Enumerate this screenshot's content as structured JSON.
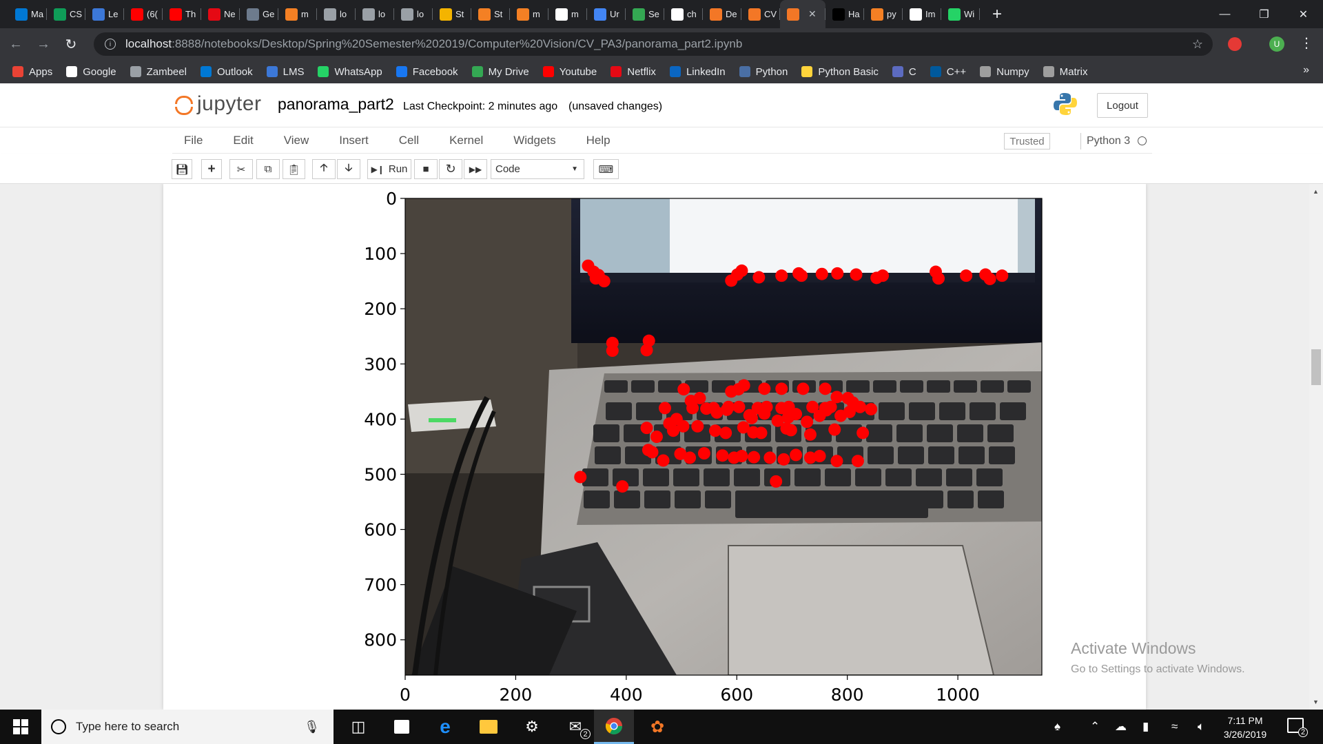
{
  "browser": {
    "tabs": [
      {
        "label": "Ma",
        "icon": "outlook-icon",
        "color": "#0078d4"
      },
      {
        "label": "CS",
        "icon": "plus-sheet-icon",
        "color": "#0f9d58"
      },
      {
        "label": "Le",
        "icon": "lms-icon",
        "color": "#3c78d8"
      },
      {
        "label": "(6(",
        "icon": "youtube-icon",
        "color": "#ff0000"
      },
      {
        "label": "Th",
        "icon": "youtube-icon",
        "color": "#ff0000"
      },
      {
        "label": "Ne",
        "icon": "netflix-icon",
        "color": "#e50914"
      },
      {
        "label": "Ge",
        "icon": "page-icon",
        "color": "#6d7b8d"
      },
      {
        "label": "m",
        "icon": "stack-icon",
        "color": "#f48024"
      },
      {
        "label": "lo",
        "icon": "file-icon",
        "color": "#9aa0a6"
      },
      {
        "label": "lo",
        "icon": "file-icon",
        "color": "#9aa0a6"
      },
      {
        "label": "lo",
        "icon": "file-icon",
        "color": "#9aa0a6"
      },
      {
        "label": "St",
        "icon": "star-icon",
        "color": "#f4b400"
      },
      {
        "label": "St",
        "icon": "diamond-icon",
        "color": "#f48024"
      },
      {
        "label": "m",
        "icon": "stack-icon",
        "color": "#f48024"
      },
      {
        "label": "m",
        "icon": "google-icon",
        "color": "#ffffff"
      },
      {
        "label": "Ur",
        "icon": "drive-icon",
        "color": "#4285f4"
      },
      {
        "label": "Se",
        "icon": "pen-icon",
        "color": "#34a853"
      },
      {
        "label": "ch",
        "icon": "google-icon",
        "color": "#ffffff"
      },
      {
        "label": "De",
        "icon": "jupyter-icon",
        "color": "#f37726"
      },
      {
        "label": "CV",
        "icon": "notebook-icon",
        "color": "#f37726"
      },
      {
        "label": "",
        "icon": "notebook-icon",
        "color": "#f37726",
        "active": true
      },
      {
        "label": "Ha",
        "icon": "github-icon",
        "color": "#000000"
      },
      {
        "label": "py",
        "icon": "stack-icon",
        "color": "#f48024"
      },
      {
        "label": "Im",
        "icon": "pinwheel-icon",
        "color": "#ffffff"
      },
      {
        "label": "Wi",
        "icon": "whatsapp-icon",
        "color": "#25d366"
      }
    ],
    "url_host": "localhost",
    "url_rest": ":8888/notebooks/Desktop/Spring%20Semester%202019/Computer%20Vision/CV_PA3/panorama_part2.ipynb",
    "profile_initial": "U",
    "bookmarks": [
      {
        "label": "Apps",
        "icon": "apps-grid-icon",
        "color": "#ea4335"
      },
      {
        "label": "Google",
        "icon": "google-icon",
        "color": "#ffffff"
      },
      {
        "label": "Zambeel",
        "icon": "page-icon",
        "color": "#9aa0a6"
      },
      {
        "label": "Outlook",
        "icon": "outlook-icon",
        "color": "#0078d4"
      },
      {
        "label": "LMS",
        "icon": "lms-icon",
        "color": "#3c78d8"
      },
      {
        "label": "WhatsApp",
        "icon": "whatsapp-icon",
        "color": "#25d366"
      },
      {
        "label": "Facebook",
        "icon": "facebook-icon",
        "color": "#1877f2"
      },
      {
        "label": "My Drive",
        "icon": "drive-icon",
        "color": "#34a853"
      },
      {
        "label": "Youtube",
        "icon": "youtube-icon",
        "color": "#ff0000"
      },
      {
        "label": "Netflix",
        "icon": "netflix-icon",
        "color": "#e50914"
      },
      {
        "label": "LinkedIn",
        "icon": "linkedin-icon",
        "color": "#0a66c2"
      },
      {
        "label": "Python",
        "icon": "globe-icon",
        "color": "#4a6fa5"
      },
      {
        "label": "Python Basic",
        "icon": "python-icon",
        "color": "#ffd43b"
      },
      {
        "label": "C",
        "icon": "c-icon",
        "color": "#5c6bc0"
      },
      {
        "label": "C++",
        "icon": "cpp-icon",
        "color": "#00599c"
      },
      {
        "label": "Numpy",
        "icon": "numpy-icon",
        "color": "#9e9e9e"
      },
      {
        "label": "Matrix",
        "icon": "r-icon",
        "color": "#9e9e9e"
      }
    ]
  },
  "jupyter": {
    "logo_text": "jupyter",
    "notebook_name": "panorama_part2",
    "checkpoint": "Last Checkpoint: 2 minutes ago",
    "status": "(unsaved changes)",
    "logout": "Logout",
    "menu": [
      "File",
      "Edit",
      "View",
      "Insert",
      "Cell",
      "Kernel",
      "Widgets",
      "Help"
    ],
    "trusted": "Trusted",
    "kernel": "Python 3",
    "run_label": "Run",
    "cell_type": "Code"
  },
  "chart_data": {
    "type": "scatter",
    "title": "",
    "xlabel": "",
    "ylabel": "",
    "xlim": [
      0,
      1152
    ],
    "ylim": [
      864,
      0
    ],
    "y_inverted": true,
    "xticks": [
      "0",
      "200",
      "400",
      "600",
      "800",
      "1000"
    ],
    "yticks": [
      "0",
      "100",
      "200",
      "300",
      "400",
      "500",
      "600",
      "700",
      "800"
    ],
    "background": "photo of laptop keyboard (imshow)",
    "marker_color": "#ff0000",
    "series": [
      {
        "points": [
          [
            331,
            122
          ],
          [
            341,
            133
          ],
          [
            345,
            145
          ],
          [
            360,
            150
          ],
          [
            350,
            139
          ],
          [
            590,
            149
          ],
          [
            601,
            138
          ],
          [
            609,
            131
          ],
          [
            640,
            143
          ],
          [
            681,
            140
          ],
          [
            712,
            136
          ],
          [
            717,
            140
          ],
          [
            754,
            137
          ],
          [
            782,
            136
          ],
          [
            816,
            138
          ],
          [
            853,
            144
          ],
          [
            864,
            140
          ],
          [
            960,
            133
          ],
          [
            965,
            145
          ],
          [
            1015,
            140
          ],
          [
            1050,
            138
          ],
          [
            1058,
            146
          ],
          [
            1080,
            140
          ],
          [
            375,
            262
          ],
          [
            375,
            276
          ],
          [
            441,
            258
          ],
          [
            437,
            275
          ],
          [
            470,
            380
          ],
          [
            478,
            408
          ],
          [
            491,
            400
          ],
          [
            520,
            380
          ],
          [
            545,
            381
          ],
          [
            558,
            380
          ],
          [
            585,
            378
          ],
          [
            604,
            378
          ],
          [
            638,
            380
          ],
          [
            654,
            378
          ],
          [
            681,
            380
          ],
          [
            694,
            378
          ],
          [
            737,
            378
          ],
          [
            760,
            380
          ],
          [
            770,
            378
          ],
          [
            810,
            370
          ],
          [
            504,
            346
          ],
          [
            517,
            367
          ],
          [
            533,
            362
          ],
          [
            564,
            388
          ],
          [
            582,
            383
          ],
          [
            623,
            393
          ],
          [
            627,
            398
          ],
          [
            650,
            390
          ],
          [
            674,
            403
          ],
          [
            693,
            397
          ],
          [
            707,
            391
          ],
          [
            727,
            405
          ],
          [
            750,
            394
          ],
          [
            762,
            384
          ],
          [
            788,
            394
          ],
          [
            804,
            387
          ],
          [
            823,
            378
          ],
          [
            843,
            382
          ],
          [
            590,
            350
          ],
          [
            603,
            346
          ],
          [
            613,
            339
          ],
          [
            650,
            345
          ],
          [
            681,
            345
          ],
          [
            720,
            345
          ],
          [
            760,
            345
          ],
          [
            781,
            360
          ],
          [
            801,
            362
          ],
          [
            437,
            416
          ],
          [
            455,
            432
          ],
          [
            485,
            421
          ],
          [
            503,
            413
          ],
          [
            529,
            413
          ],
          [
            561,
            421
          ],
          [
            580,
            425
          ],
          [
            612,
            415
          ],
          [
            630,
            424
          ],
          [
            644,
            425
          ],
          [
            690,
            417
          ],
          [
            698,
            420
          ],
          [
            733,
            428
          ],
          [
            777,
            419
          ],
          [
            828,
            425
          ],
          [
            440,
            456
          ],
          [
            447,
            460
          ],
          [
            467,
            475
          ],
          [
            498,
            463
          ],
          [
            515,
            470
          ],
          [
            541,
            462
          ],
          [
            574,
            466
          ],
          [
            595,
            470
          ],
          [
            609,
            467
          ],
          [
            631,
            469
          ],
          [
            660,
            470
          ],
          [
            685,
            473
          ],
          [
            707,
            465
          ],
          [
            733,
            470
          ],
          [
            750,
            467
          ],
          [
            781,
            476
          ],
          [
            819,
            476
          ],
          [
            317,
            505
          ],
          [
            393,
            522
          ],
          [
            671,
            513
          ]
        ]
      }
    ]
  },
  "watermark": {
    "line1": "Activate Windows",
    "line2": "Go to Settings to activate Windows."
  },
  "taskbar": {
    "search_placeholder": "Type here to search",
    "time": "7:11 PM",
    "date": "3/26/2019",
    "mail_badge": "2",
    "notif_badge": "2"
  }
}
